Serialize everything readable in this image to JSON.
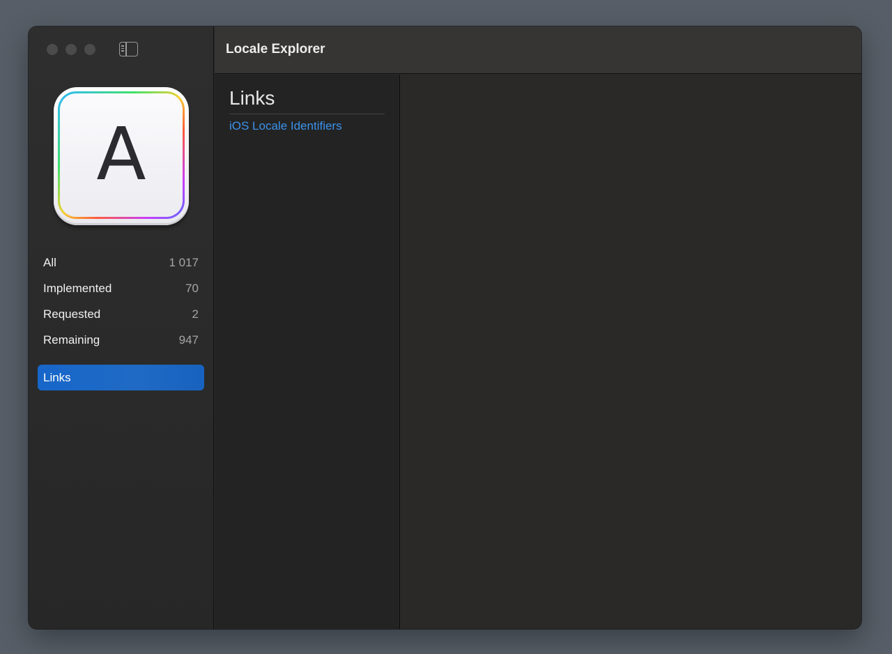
{
  "window": {
    "title": "Locale Explorer"
  },
  "sidebar": {
    "app_icon": {
      "letter": "A",
      "icon": "locale-explorer-app-icon"
    },
    "stats": [
      {
        "label": "All",
        "count": "1 017"
      },
      {
        "label": "Implemented",
        "count": "70"
      },
      {
        "label": "Requested",
        "count": "2"
      },
      {
        "label": "Remaining",
        "count": "947"
      }
    ],
    "links_label": "Links",
    "toggle_icon": "sidebar-toggle-icon"
  },
  "content": {
    "heading": "Links",
    "items": [
      {
        "label": "iOS Locale Identifiers"
      }
    ]
  },
  "colors": {
    "accent": "#1766c9",
    "link": "#3b93ec",
    "background": "#2a2928"
  }
}
